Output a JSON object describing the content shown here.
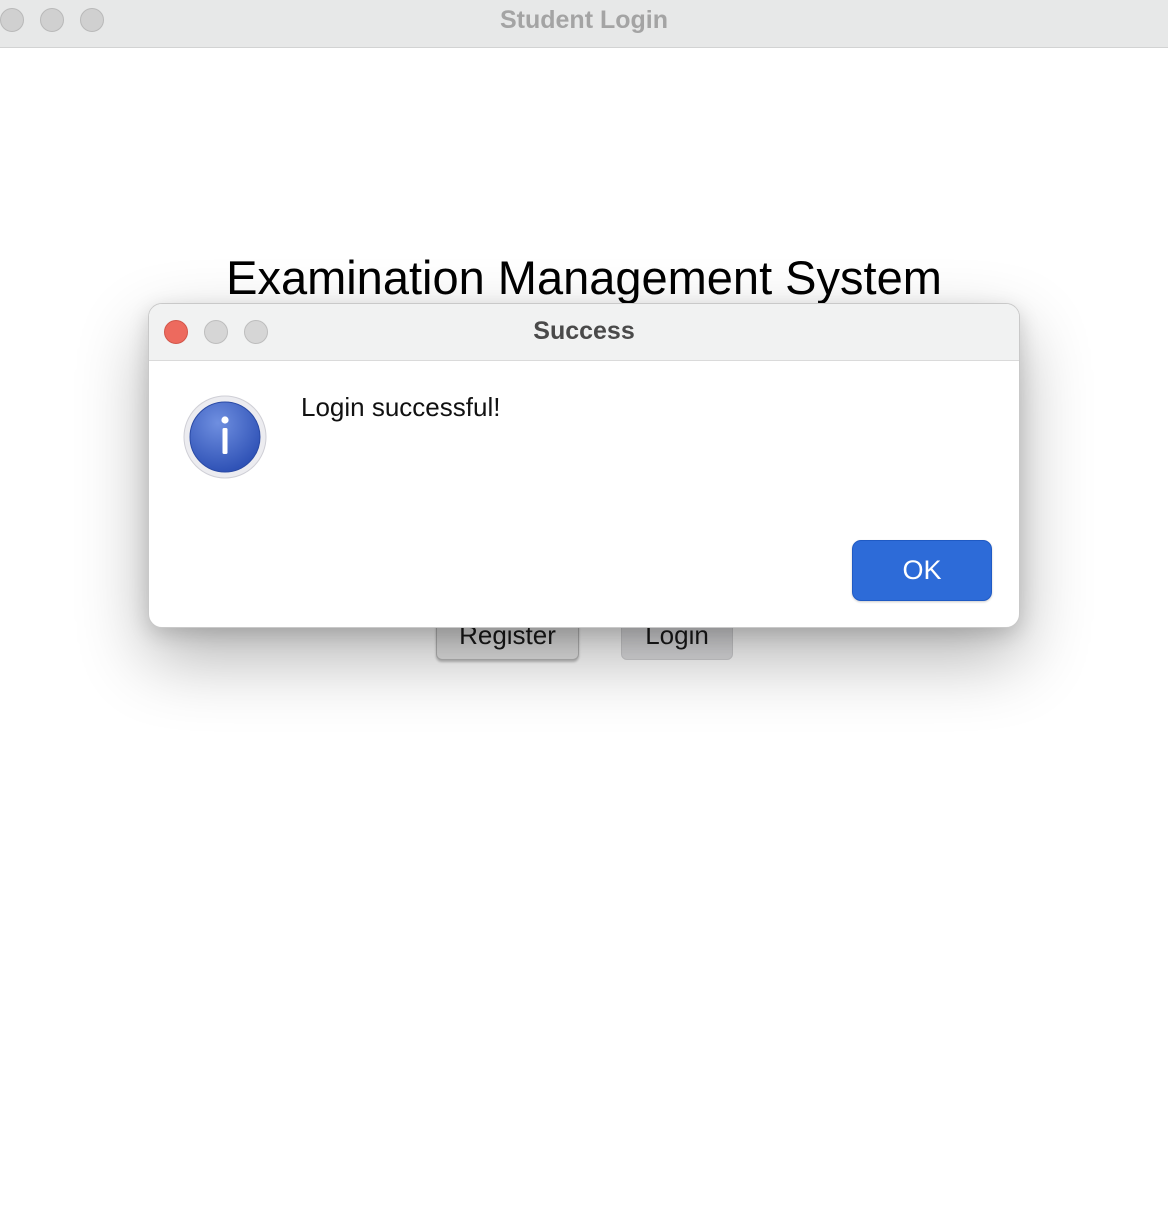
{
  "window": {
    "title": "Student Login"
  },
  "main": {
    "heading": "Examination Management System",
    "register_label": "Register",
    "login_label": "Login"
  },
  "dialog": {
    "title": "Success",
    "message": "Login successful!",
    "ok_label": "OK",
    "icon": "info-icon"
  },
  "colors": {
    "accent": "#2d6bd8",
    "close_button": "#ed6a5e"
  }
}
